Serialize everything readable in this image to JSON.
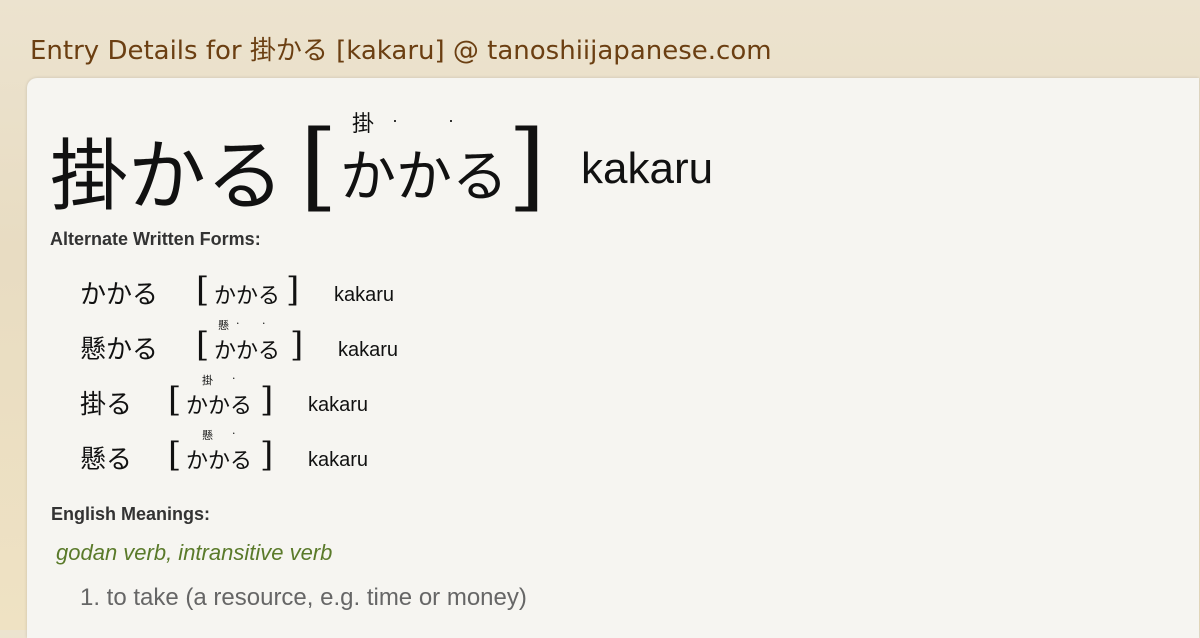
{
  "page": {
    "title": "Entry Details for 掛かる [kakaru] @ tanoshiijapanese.com"
  },
  "entry": {
    "word": "掛かる",
    "reading_kana": "かかる",
    "reading_furigana": "掛",
    "romaji": "kakaru"
  },
  "sections": {
    "alternate_label": "Alternate Written Forms:",
    "meanings_label": "English Meanings:"
  },
  "alternates": [
    {
      "word": "かかる",
      "kana": "かかる",
      "furigana": "",
      "romaji": "kakaru"
    },
    {
      "word": "懸かる",
      "kana": "かかる",
      "furigana": "懸",
      "romaji": "kakaru"
    },
    {
      "word": "掛る",
      "kana": "かかる",
      "furigana": "掛",
      "romaji": "kakaru"
    },
    {
      "word": "懸る",
      "kana": "かかる",
      "furigana": "懸",
      "romaji": "kakaru"
    }
  ],
  "meanings": {
    "part_of_speech": "godan verb, intransitive verb",
    "items": [
      "1. to take (a resource, e.g. time or money)"
    ]
  }
}
